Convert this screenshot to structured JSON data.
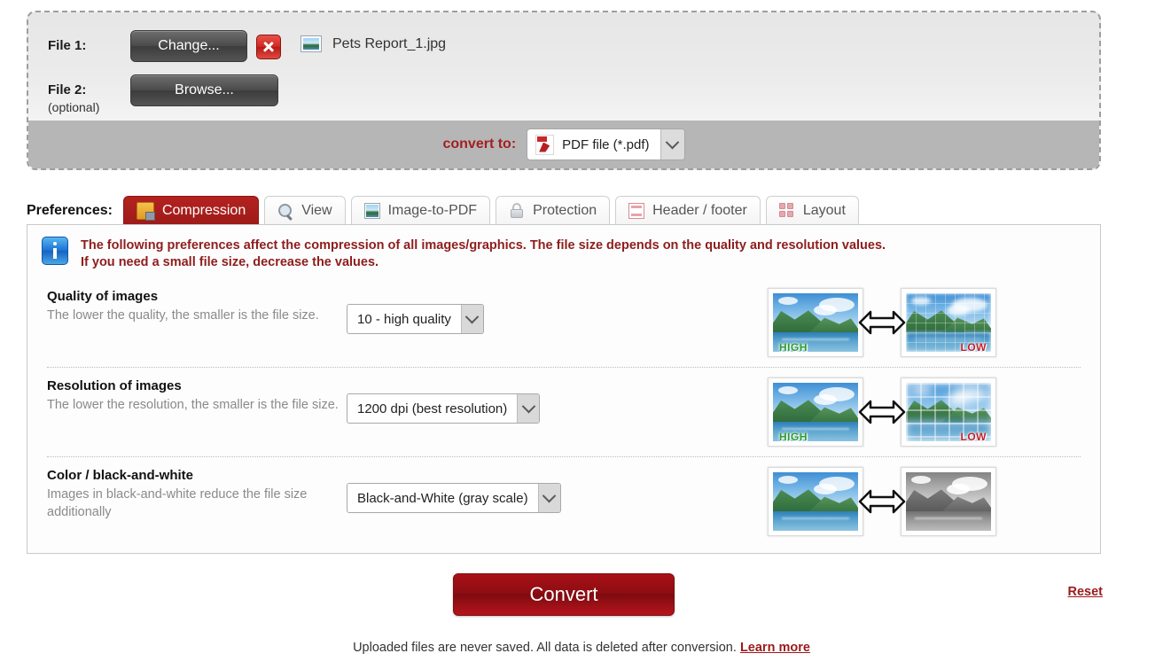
{
  "upload": {
    "file1_label": "File 1:",
    "file2_label": "File 2:",
    "file2_sub": "(optional)",
    "change_button": "Change...",
    "browse_button": "Browse...",
    "delete_icon": "delete-x-icon",
    "file1_thumb_icon": "image-thumbnail-icon",
    "file1_name": "Pets Report_1.jpg",
    "convert_to_label": "convert to:",
    "convert_to_value": "PDF file (*.pdf)",
    "convert_to_icon": "pdf-file-icon"
  },
  "preferences": {
    "title": "Preferences:",
    "tabs": [
      {
        "label": "Compression",
        "icon": "compression-icon",
        "active": true
      },
      {
        "label": "View",
        "icon": "magnifier-icon",
        "active": false
      },
      {
        "label": "Image-to-PDF",
        "icon": "image-icon",
        "active": false
      },
      {
        "label": "Protection",
        "icon": "padlock-icon",
        "active": false
      },
      {
        "label": "Header / footer",
        "icon": "page-icon",
        "active": false
      },
      {
        "label": "Layout",
        "icon": "layout-grid-icon",
        "active": false
      }
    ],
    "notice_icon": "info-icon",
    "notice_line1": "The following preferences affect the compression of all images/graphics. The file size depends on the quality and resolution values.",
    "notice_line2": "If you need a small file size, decrease the values.",
    "options": [
      {
        "title": "Quality of images",
        "desc": "The lower the quality, the smaller is the file size.",
        "value": "10 - high quality",
        "left_tag": "HIGH",
        "right_tag": "LOW"
      },
      {
        "title": "Resolution of images",
        "desc": "The lower the resolution, the smaller is the file size.",
        "value": "1200 dpi (best resolution)",
        "left_tag": "HIGH",
        "right_tag": "LOW"
      },
      {
        "title": "Color / black-and-white",
        "desc": "Images in black-and-white reduce the file size additionally",
        "value": "Black-and-White (gray scale)",
        "left_tag": "",
        "right_tag": ""
      }
    ]
  },
  "footer": {
    "convert_button": "Convert",
    "reset_link": "Reset",
    "note_text": "Uploaded files are never saved. All data is deleted after conversion. ",
    "note_link": "Learn more"
  },
  "colors": {
    "accent_red": "#9d1b19",
    "convert_red": "#8e0d12",
    "notice_red": "#8e1d1d",
    "tag_high_green": "#2f9c32",
    "tag_low_red": "#c4222a"
  }
}
